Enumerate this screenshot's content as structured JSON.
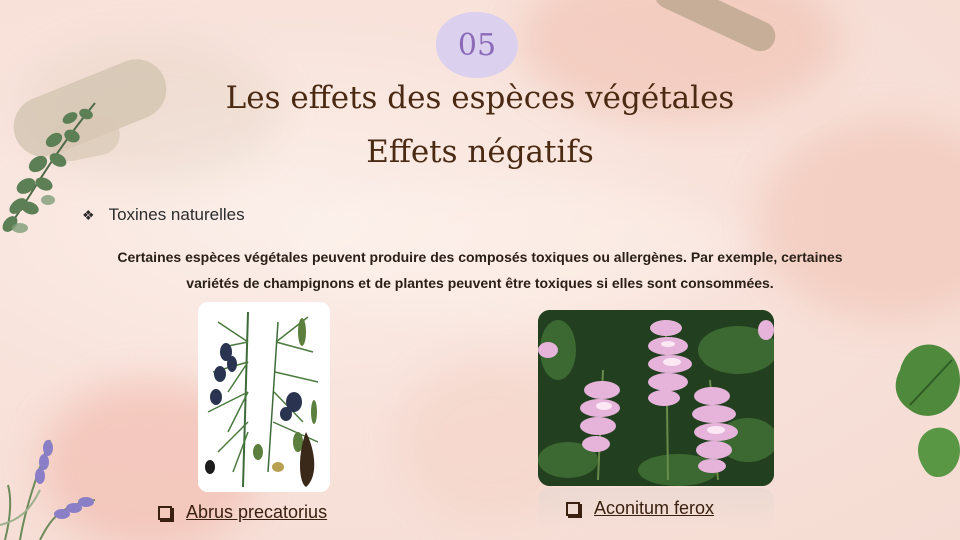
{
  "slide": {
    "number": "05",
    "title_line1": "Les effets des espèces végétales",
    "title_line2": "Effets négatifs"
  },
  "section": {
    "bullet_icon": "diamond-bullet-icon",
    "heading": "Toxines naturelles",
    "paragraph_line1": "Certaines espèces végétales peuvent produire des composés toxiques ou allergènes. Par exemple, certaines",
    "paragraph_line2": "variétés de champignons et de plantes peuvent être toxiques si elles sont consommées."
  },
  "figures": [
    {
      "caption": "Abrus precatorius",
      "icon": "checkbox-bullet-icon"
    },
    {
      "caption": "Aconitum ferox",
      "icon": "checkbox-bullet-icon"
    }
  ],
  "colors": {
    "title": "#4a2a12",
    "number": "#8b6bb8",
    "number_blob": "#dcd0ef",
    "background": "#f8e2da"
  }
}
